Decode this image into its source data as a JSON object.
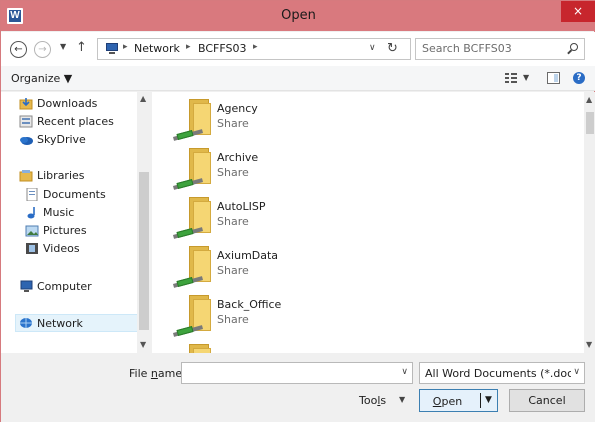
{
  "window": {
    "title": "Open",
    "app_icon_letter": "W",
    "close_glyph": "×"
  },
  "navbar": {
    "back_glyph": "←",
    "forward_glyph": "→",
    "recent_dropdown_glyph": "▼",
    "up_glyph": "↑",
    "breadcrumb": [
      "Network",
      "BCFFS03"
    ],
    "breadcrumb_separator": "▸",
    "address_dropdown_glyph": "∨",
    "refresh_glyph": "↻",
    "search_placeholder": "Search BCFFS03"
  },
  "toolbar": {
    "organize_label": "Organize ▼",
    "view_dropdown_glyph": "▼",
    "help_glyph": "?"
  },
  "nav_pane": {
    "items": [
      {
        "label": "Downloads",
        "icon": "downloads-icon",
        "selected": false
      },
      {
        "label": "Recent places",
        "icon": "recent-places-icon",
        "selected": false
      },
      {
        "label": "SkyDrive",
        "icon": "skydrive-icon",
        "selected": false
      },
      {
        "label": "Libraries",
        "icon": "libraries-icon",
        "selected": false
      },
      {
        "label": "Documents",
        "icon": "documents-icon",
        "selected": false
      },
      {
        "label": "Music",
        "icon": "music-icon",
        "selected": false
      },
      {
        "label": "Pictures",
        "icon": "pictures-icon",
        "selected": false
      },
      {
        "label": "Videos",
        "icon": "videos-icon",
        "selected": false
      },
      {
        "label": "Computer",
        "icon": "computer-icon",
        "selected": false
      },
      {
        "label": "Network",
        "icon": "network-icon",
        "selected": true
      }
    ],
    "scroll_up_glyph": "▲",
    "scroll_down_glyph": "▼"
  },
  "file_pane": {
    "items": [
      {
        "name": "Agency",
        "type": "Share"
      },
      {
        "name": "Archive",
        "type": "Share"
      },
      {
        "name": "AutoLISP",
        "type": "Share"
      },
      {
        "name": "AxiumData",
        "type": "Share"
      },
      {
        "name": "Back_Office",
        "type": "Share"
      }
    ],
    "scroll_up_glyph": "▲",
    "scroll_down_glyph": "▼"
  },
  "bottom": {
    "file_name_label_pre": "File ",
    "file_name_label_key": "n",
    "file_name_label_post": "ame:",
    "file_name_value": "",
    "file_name_dropdown_glyph": "∨",
    "file_type_filter": "All Word Documents (*.docx;*.docm;*.dotx;*.dotm;*.doc;*.dot;*.htm;*.html;*.rtf;*.mht;*.mhtml;*.xml;*.odt;*.pdf)",
    "file_type_dropdown_glyph": "∨",
    "tools_label_pre": "Too",
    "tools_label_key": "l",
    "tools_label_post": "s",
    "tools_dropdown_glyph": "▼",
    "open_label_key": "O",
    "open_label_post": "pen",
    "open_dropdown_glyph": "▼",
    "cancel_label": "Cancel"
  },
  "colors": {
    "titlebar": "#d9797e",
    "close_button": "#c7262d",
    "selection": "#e5f3fb",
    "primary_button_border": "#3c7fb1"
  }
}
